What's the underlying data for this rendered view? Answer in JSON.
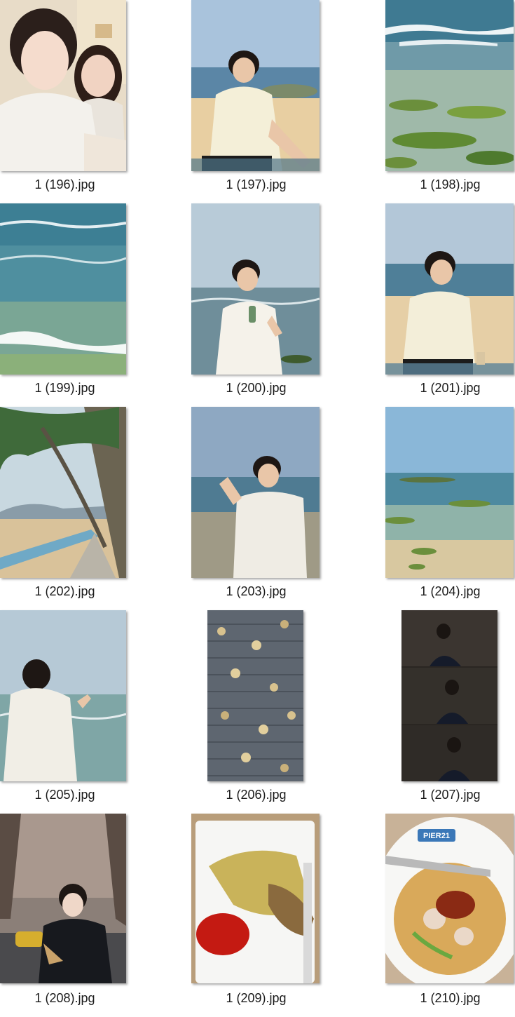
{
  "files": [
    {
      "name": "1 (196).jpg",
      "icon": "photo-selfie-couple-icon"
    },
    {
      "name": "1 (197).jpg",
      "icon": "photo-beach-portrait-icon"
    },
    {
      "name": "1 (198).jpg",
      "icon": "photo-sea-rocks-icon"
    },
    {
      "name": "1 (199).jpg",
      "icon": "photo-sea-waves-icon"
    },
    {
      "name": "1 (200).jpg",
      "icon": "photo-sea-portrait-icon"
    },
    {
      "name": "1 (201).jpg",
      "icon": "photo-beach-portrait-icon"
    },
    {
      "name": "1 (202).jpg",
      "icon": "photo-palm-trees-icon"
    },
    {
      "name": "1 (203).jpg",
      "icon": "photo-sea-portrait-icon"
    },
    {
      "name": "1 (204).jpg",
      "icon": "photo-sea-rocks-icon"
    },
    {
      "name": "1 (205).jpg",
      "icon": "photo-sea-back-portrait-icon"
    },
    {
      "name": "1 (206).jpg",
      "icon": "photo-leaves-pavement-icon"
    },
    {
      "name": "1 (207).jpg",
      "icon": "photo-collage-portrait-icon"
    },
    {
      "name": "1 (208).jpg",
      "icon": "photo-street-portrait-icon"
    },
    {
      "name": "1 (209).jpg",
      "icon": "photo-food-plate-icon"
    },
    {
      "name": "1 (210).jpg",
      "icon": "photo-noodle-bowl-icon"
    }
  ],
  "bowl_label": "PIER21"
}
